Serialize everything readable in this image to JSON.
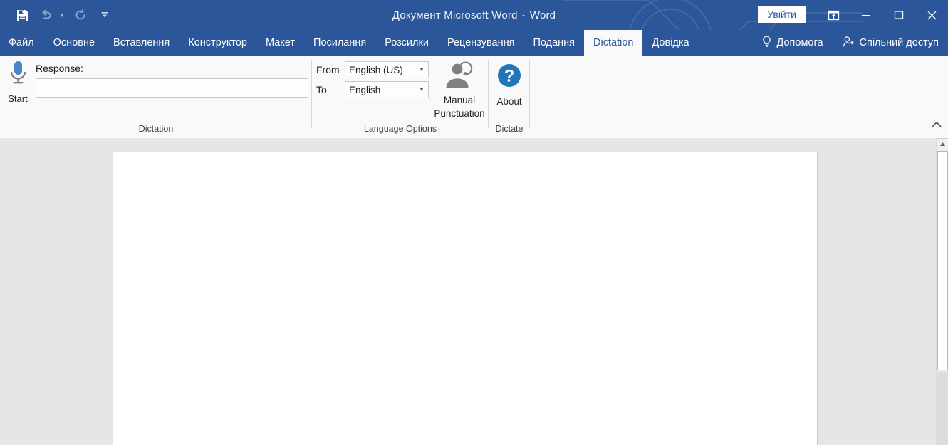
{
  "titlebar": {
    "quick_access": [
      {
        "name": "save-icon",
        "label": "Save"
      },
      {
        "name": "undo-icon",
        "label": "Undo"
      },
      {
        "name": "redo-icon",
        "label": "Redo"
      },
      {
        "name": "customize-quick-access-icon",
        "label": "Customize Quick Access Toolbar"
      }
    ],
    "document_name": "Документ Microsoft Word",
    "separator": "-",
    "app_name": "Word",
    "signin_label": "Увійти",
    "ribbon_display_options": "Ribbon Display Options",
    "minimize": "Minimize",
    "maximize": "Maximize",
    "close": "Close"
  },
  "tabs": [
    {
      "label": "Файл",
      "active": false
    },
    {
      "label": "Основне",
      "active": false
    },
    {
      "label": "Вставлення",
      "active": false
    },
    {
      "label": "Конструктор",
      "active": false
    },
    {
      "label": "Макет",
      "active": false
    },
    {
      "label": "Посилання",
      "active": false
    },
    {
      "label": "Розсилки",
      "active": false
    },
    {
      "label": "Рецензування",
      "active": false
    },
    {
      "label": "Подання",
      "active": false
    },
    {
      "label": "Dictation",
      "active": true
    },
    {
      "label": "Довідка",
      "active": false
    }
  ],
  "tabs_right": {
    "help_label": "Допомога",
    "share_label": "Спільний доступ"
  },
  "ribbon": {
    "groups": [
      {
        "name": "dictation",
        "label": "Dictation",
        "start_button_label": "Start",
        "response_label": "Response:",
        "response_value": "",
        "response_placeholder": ""
      },
      {
        "name": "language-options",
        "label": "Language Options",
        "from_label": "From",
        "from_value": "English (US)",
        "to_label": "To",
        "to_value": "English",
        "manual_punctuation_line1": "Manual",
        "manual_punctuation_line2": "Punctuation"
      },
      {
        "name": "dictate",
        "label": "Dictate",
        "about_label": "About"
      }
    ],
    "collapse_label": "Collapse the Ribbon"
  },
  "document": {
    "caret_visible": true
  },
  "scrollbar": {
    "up_label": "Scroll Up"
  },
  "colors": {
    "brand_blue": "#2b579a",
    "ribbon_bg": "#f9f9f9",
    "workspace_bg": "#e6e6e6",
    "mic_blue": "#4a84c4",
    "about_blue": "#2176ba"
  }
}
